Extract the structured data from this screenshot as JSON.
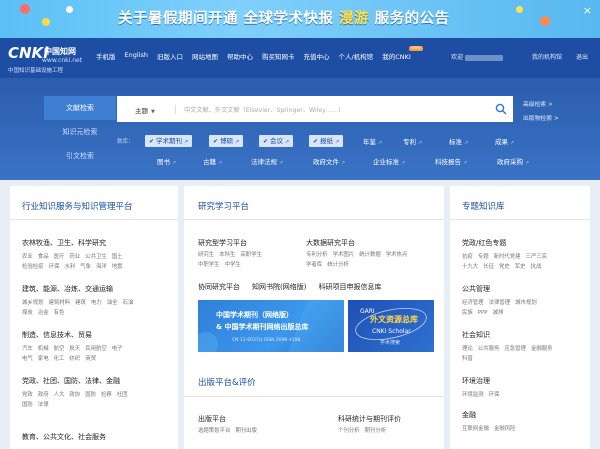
{
  "banner": {
    "text_before": "关于暑假期间开通 全球学术快报",
    "text_highlight": "漫游",
    "text_after": "服务的公告",
    "close": "×"
  },
  "header": {
    "logo_main": "CNKi",
    "logo_cn": "中国知网",
    "logo_url": "www.cnki.net",
    "logo_sub": "中国知识基础设施工程",
    "nav": [
      "手机版",
      "English",
      "旧版入口",
      "网站地图",
      "帮助中心",
      "购买知网卡",
      "充值中心",
      "个人/机构馆",
      "我的CNKI"
    ],
    "nav_badge": "new",
    "welcome": "欢迎",
    "links": [
      "我的机构馆",
      "退出"
    ]
  },
  "search": {
    "side_tabs": [
      "文献检索",
      "知识元检索",
      "引文检索"
    ],
    "field": "主题",
    "placeholder": "中文文献、外文文献（Elsevier、Springer、Wiley……）",
    "adv_links": [
      "高级检索 >",
      "出版物检索 >"
    ],
    "db_label": "数库：",
    "checked_dbs": [
      "学术期刊",
      "博硕",
      "会议",
      "报纸"
    ],
    "other_dbs_row1": [
      "年鉴",
      "专利",
      "标准",
      "成果"
    ],
    "other_dbs_row2": [
      "图书",
      "古籍",
      "法律法规",
      "政府文件",
      "企业标准",
      "科技报告",
      "政府采购"
    ]
  },
  "col1": {
    "title": "行业知识服务与知识管理平台",
    "categories": [
      {
        "heading": "农林牧渔、卫生、科学研究",
        "items": [
          "农业",
          "食品",
          "医疗",
          "药业",
          "公共卫生",
          "国土",
          "检验检疫",
          "环保",
          "水利",
          "气象",
          "海洋",
          "地震"
        ]
      },
      {
        "heading": "建筑、能源、冶炼、交通运输",
        "items": [
          "城乡规划",
          "建筑材料",
          "建筑",
          "电力",
          "油全",
          "石油",
          "煤炭",
          "冶金",
          "有色"
        ]
      },
      {
        "heading": "制造、信息技术、贸易",
        "items": [
          "汽车",
          "机械",
          "航空",
          "航天",
          "民用航空",
          "电子",
          "电气",
          "家电",
          "化工",
          "纺织",
          "商贸"
        ]
      },
      {
        "heading": "党政、社团、国防、法律、金融",
        "items": [
          "党政",
          "政府",
          "人大",
          "政协",
          "国防",
          "检察",
          "社团",
          "国防",
          "法律"
        ]
      },
      {
        "heading": "教育、公共文化、社会服务",
        "items": []
      }
    ]
  },
  "col2": {
    "title": "研究学习平台",
    "sections": [
      {
        "heading": "研究型学习平台",
        "items": [
          "研究生",
          "本科生",
          "高职学生",
          "中职学生",
          "中学生"
        ]
      },
      {
        "heading": "大数据研究平台",
        "items": [
          "专利分析",
          "学术图片",
          "统计数据",
          "学术热点",
          "学者库",
          "统计分析"
        ]
      }
    ],
    "links": [
      "协同研究平台",
      "知网书院(网络版)",
      "科研项目申报信息库"
    ],
    "ad1": {
      "line1": "中国学术期刊",
      "line1_suffix": "（网络版）",
      "line2": "& 中国学术期刊网络出版总库",
      "line3": "CN 11-6037/z  ISSN 2096-4188"
    },
    "ad2": {
      "gari": "GARI",
      "line1": "外文资源总库",
      "line2": "CNKI Scholar",
      "line3": "学术搜索"
    },
    "pub_title": "出版平台&评价",
    "bottom_sections": [
      {
        "heading": "出版平台",
        "items": [
          "选题策划平台",
          "期刊出版"
        ]
      },
      {
        "heading": "科研统计与期刊评价",
        "items": [
          "个刊分析",
          "期刊分析"
        ]
      }
    ]
  },
  "col3": {
    "title": "专题知识库",
    "topics": [
      {
        "heading": "党政/红色专题",
        "items": [
          "抗疫",
          "专题",
          "新时代党建",
          "三严三实",
          "十九大",
          "长征",
          "党史",
          "军史",
          "抗战"
        ]
      },
      {
        "heading": "公共管理",
        "items": [
          "经济管理",
          "法律管理",
          "城市规划",
          "民族",
          "PPP",
          "减排"
        ]
      },
      {
        "heading": "社会知识",
        "items": [
          "理论",
          "公共服务",
          "应急管理",
          "金融服务",
          "科普"
        ]
      },
      {
        "heading": "环境治理",
        "items": [
          "环境监测",
          "环保"
        ]
      },
      {
        "heading": "金融",
        "items": [
          "互联网金融",
          "金融风险"
        ]
      }
    ]
  },
  "colors": {
    "header_bg": "#1d4ea3",
    "search_bg": "#2b5dad",
    "accent": "#1d4ea3",
    "banner_highlight": "#ffe14a"
  }
}
